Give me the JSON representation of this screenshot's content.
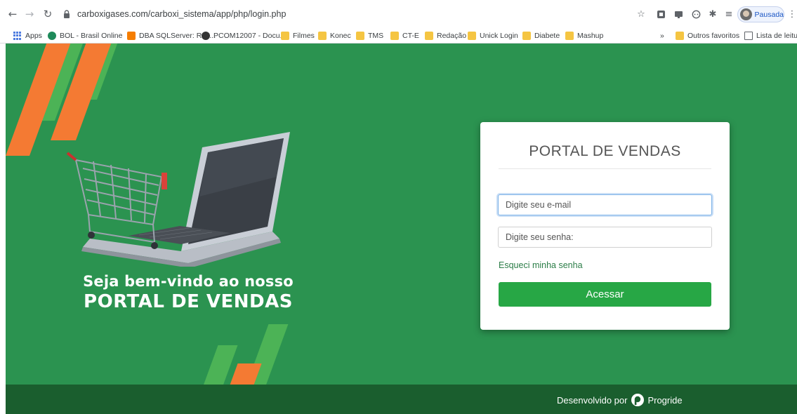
{
  "browser": {
    "url": "carboxigases.com/carboxi_sistema/app/php/login.php",
    "profile_label": "Pausada",
    "bookmarks": [
      {
        "label": "Apps",
        "icon": "apps-grid-icon"
      },
      {
        "label": "BOL - Brasil Online",
        "icon": "bol-icon"
      },
      {
        "label": "DBA SQLServer: Rec...",
        "icon": "blogger-icon"
      },
      {
        "label": "PCOM12007 - Docu...",
        "icon": "site-icon"
      },
      {
        "label": "Filmes",
        "icon": "folder-icon"
      },
      {
        "label": "Konec",
        "icon": "folder-icon"
      },
      {
        "label": "TMS",
        "icon": "folder-icon"
      },
      {
        "label": "CT-E",
        "icon": "folder-icon"
      },
      {
        "label": "Redação",
        "icon": "folder-icon"
      },
      {
        "label": "Unick Login",
        "icon": "folder-icon"
      },
      {
        "label": "Diabete",
        "icon": "folder-icon"
      },
      {
        "label": "Mashup",
        "icon": "folder-icon"
      }
    ],
    "overflow_label": "»",
    "other_favorites": "Outros favoritos",
    "reading_list": "Lista de leitura"
  },
  "hero": {
    "line1": "Seja bem-vindo ao nosso",
    "line2": "PORTAL DE VENDAS"
  },
  "login": {
    "title": "PORTAL DE VENDAS",
    "email_placeholder": "Digite seu e-mail",
    "password_placeholder": "Digite seu senha:",
    "forgot_label": "Esqueci minha senha",
    "submit_label": "Acessar"
  },
  "footer": {
    "developed_by": "Desenvolvido por",
    "brand": "Progride"
  },
  "colors": {
    "page_bg": "#2b9350",
    "footer_bg": "#1a5e2e",
    "accent_orange": "#f47a33",
    "accent_light_green": "#4cb356",
    "button_green": "#27a745"
  }
}
